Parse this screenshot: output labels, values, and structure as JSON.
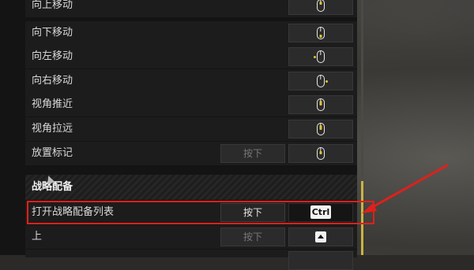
{
  "rows": [
    {
      "label": "向上移动",
      "key1": "",
      "key2_icon": "mouse-scroll-up-icon"
    },
    {
      "label": "向下移动",
      "key1": "",
      "key2_icon": "mouse-scroll-down-icon"
    },
    {
      "label": "向左移动",
      "key1": "",
      "key2_icon": "mouse-scroll-left-icon"
    },
    {
      "label": "向右移动",
      "key1": "",
      "key2_icon": "mouse-scroll-right-icon"
    },
    {
      "label": "视角推近",
      "key1": "",
      "key2_icon": "mouse-wheel-up-icon"
    },
    {
      "label": "视角拉远",
      "key1": "",
      "key2_icon": "mouse-wheel-down-icon"
    },
    {
      "label": "放置标记",
      "key1": "按下",
      "key2_icon": "mouse-middle-button-icon"
    }
  ],
  "section": {
    "title": "战略配备"
  },
  "strategy_rows": [
    {
      "label": "打开战略配备列表",
      "key1": "按下",
      "key2": "Ctrl"
    },
    {
      "label": "上",
      "key1": "按下",
      "key2_icon": "arrow-up-key-icon"
    }
  ],
  "colors": {
    "accent": "#e4c23a",
    "highlight": "#e0201b",
    "scroll_thumb": "#c8b443"
  }
}
